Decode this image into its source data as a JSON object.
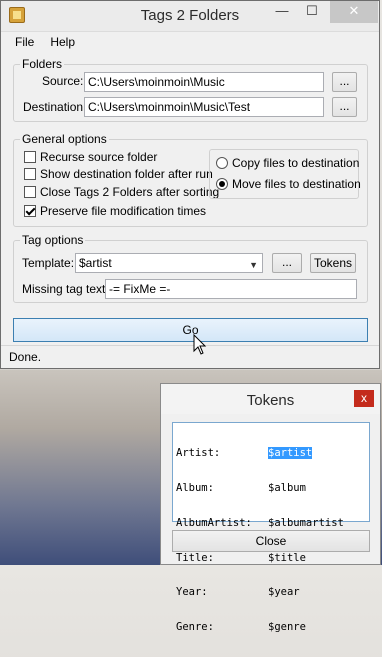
{
  "main_window": {
    "title": "Tags 2 Folders",
    "controls": {
      "minimize": "—",
      "maximize": "☐",
      "close": "✕"
    },
    "menu": [
      "File",
      "Help"
    ],
    "folders": {
      "group_title": "Folders",
      "source_label": "Source:",
      "source_value": "C:\\Users\\moinmoin\\Music",
      "destination_label": "Destination:",
      "destination_value": "C:\\Users\\moinmoin\\Music\\Test",
      "browse_label": "..."
    },
    "general_options": {
      "group_title": "General options",
      "checkboxes": [
        {
          "label": "Recurse source folder",
          "checked": false
        },
        {
          "label": "Show destination folder after run",
          "checked": false
        },
        {
          "label": "Close Tags 2 Folders after sorting",
          "checked": false
        },
        {
          "label": "Preserve file modification times",
          "checked": true
        }
      ],
      "radios": [
        {
          "label": "Copy files to destination",
          "checked": false
        },
        {
          "label": "Move files to destination",
          "checked": true
        }
      ]
    },
    "tag_options": {
      "group_title": "Tag options",
      "template_label": "Template:",
      "template_value": "$artist",
      "browse_label": "...",
      "tokens_button": "Tokens",
      "missing_label": "Missing tag text:",
      "missing_value": "-= FixMe =-"
    },
    "go_button": "Go",
    "status": "Done."
  },
  "tokens_window": {
    "title": "Tokens",
    "close_x": "x",
    "rows": [
      {
        "name": "Artist:",
        "token": "$artist",
        "selected": true
      },
      {
        "name": "Album:",
        "token": "$album",
        "selected": false
      },
      {
        "name": "AlbumArtist:",
        "token": "$albumartist",
        "selected": false
      },
      {
        "name": "Title:",
        "token": "$title",
        "selected": false
      },
      {
        "name": "Year:",
        "token": "$year",
        "selected": false
      },
      {
        "name": "Genre:",
        "token": "$genre",
        "selected": false
      }
    ],
    "close_button": "Close"
  }
}
